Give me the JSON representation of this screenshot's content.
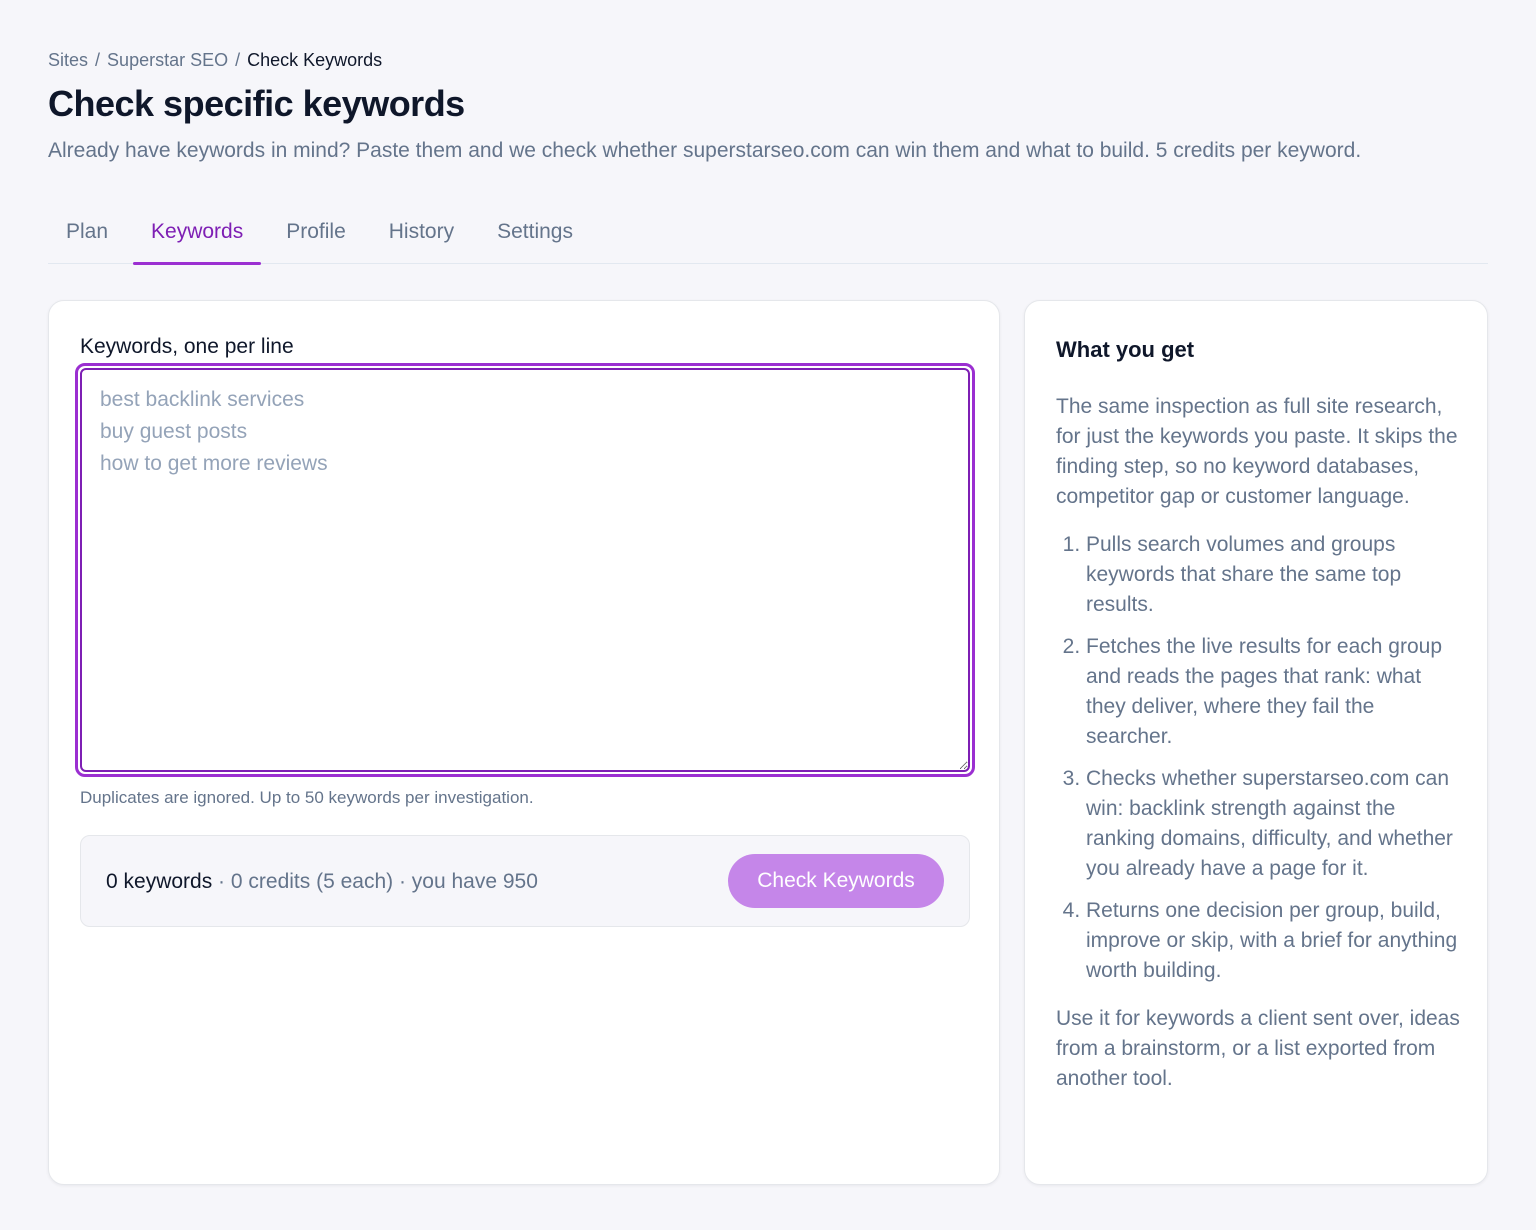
{
  "breadcrumb": {
    "items": [
      "Sites",
      "Superstar SEO",
      "Check Keywords"
    ],
    "separator": "/"
  },
  "header": {
    "title": "Check specific keywords",
    "subtitle": "Already have keywords in mind? Paste them and we check whether superstarseo.com can win them and what to build. 5 credits per keyword."
  },
  "tabs": [
    {
      "label": "Plan",
      "active": false
    },
    {
      "label": "Keywords",
      "active": true
    },
    {
      "label": "Profile",
      "active": false
    },
    {
      "label": "History",
      "active": false
    },
    {
      "label": "Settings",
      "active": false
    }
  ],
  "form": {
    "label": "Keywords, one per line",
    "value": "",
    "placeholder": "best backlink services\nbuy guest posts\nhow to get more reviews",
    "hint": "Duplicates are ignored. Up to 50 keywords per investigation."
  },
  "summary": {
    "count_text": "0 keywords",
    "details_text": " · 0 credits (5 each) · you have 950",
    "button_label": "Check Keywords"
  },
  "side": {
    "title": "What you get",
    "intro": "The same inspection as full site research, for just the keywords you paste. It skips the finding step, so no keyword databases, competitor gap or customer language.",
    "steps": [
      "Pulls search volumes and groups keywords that share the same top results.",
      "Fetches the live results for each group and reads the pages that rank: what they deliver, where they fail the searcher.",
      "Checks whether superstarseo.com can win: backlink strength against the ranking domains, difficulty, and whether you already have a page for it.",
      "Returns one decision per group, build, improve or skip, with a brief for anything worth building."
    ],
    "outro": "Use it for keywords a client sent over, ideas from a brainstorm, or a list exported from another tool."
  },
  "colors": {
    "accent": "#7e1fb4",
    "accent_border": "#9b2fd1",
    "button_bg": "#c586e9",
    "page_bg": "#f6f6fa",
    "text_primary": "#0f172a",
    "text_secondary": "#64748b"
  }
}
